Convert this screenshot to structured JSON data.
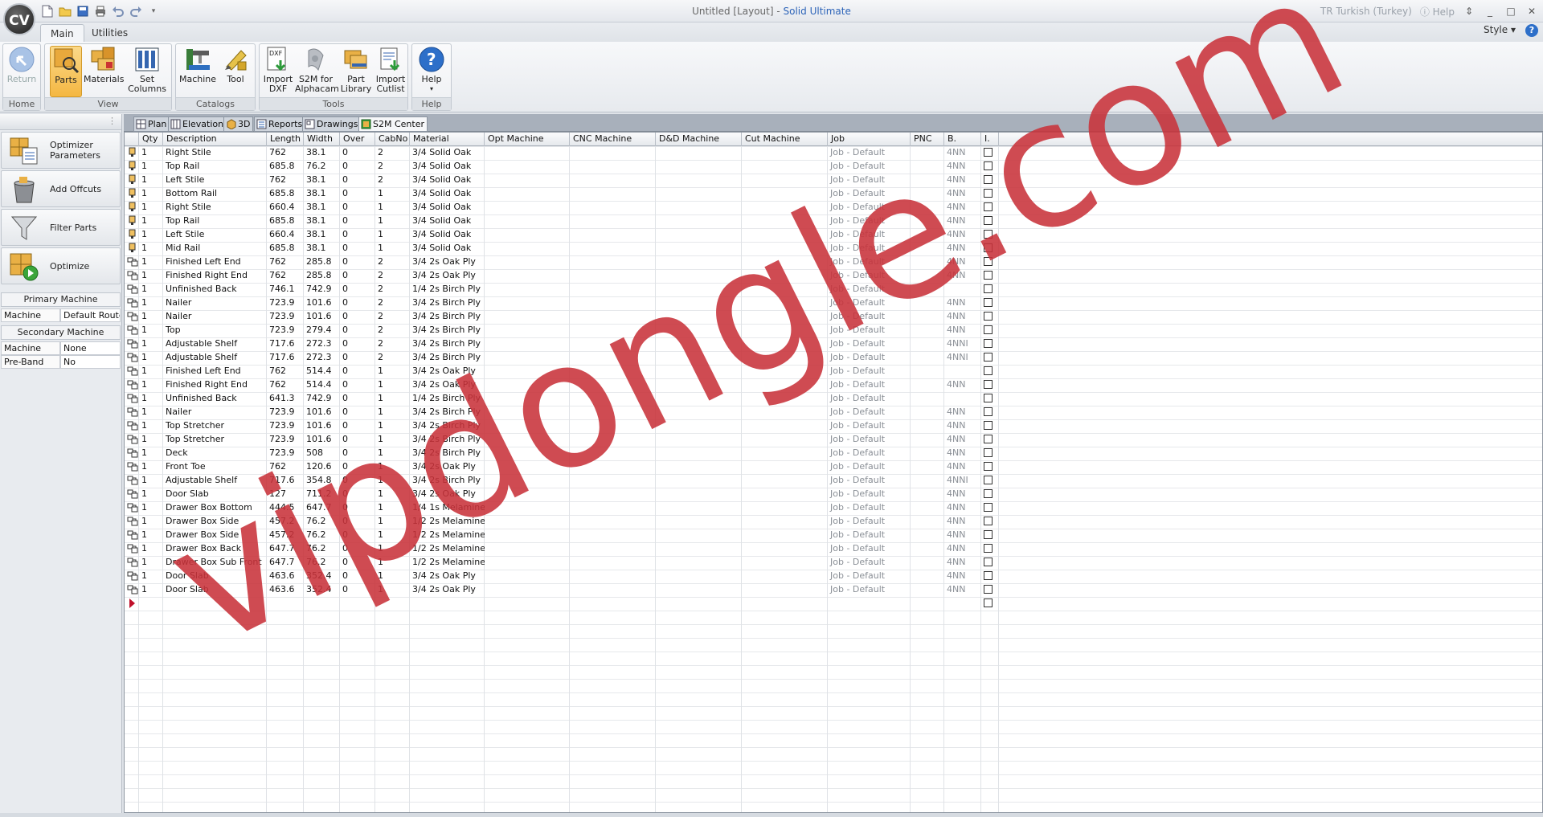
{
  "app": {
    "logo_text": "CV",
    "title_prefix": "Untitled [Layout] - ",
    "title_brand": "Solid Ultimate",
    "language": "TR Turkish (Turkey)",
    "help_label": "Help"
  },
  "ribbon_tabs": [
    {
      "label": "Main",
      "active": true
    },
    {
      "label": "Utilities",
      "active": false
    }
  ],
  "style_label": "Style",
  "ribbon": {
    "groups": {
      "home": "Home",
      "view": "View",
      "catalogs": "Catalogs",
      "tools": "Tools",
      "help": "Help"
    },
    "buttons": {
      "return": "Return",
      "parts": "Parts",
      "materials": "Materials",
      "set_columns_1": "Set",
      "set_columns_2": "Columns",
      "machine": "Machine",
      "tool": "Tool",
      "import_dxf_1": "Import",
      "import_dxf_2": "DXF",
      "s2m_1": "S2M for",
      "s2m_2": "Alphacam",
      "part_library_1": "Part",
      "part_library_2": "Library",
      "import_cutlist_1": "Import",
      "import_cutlist_2": "Cutlist",
      "help": "Help",
      "dxf_badge": "DXF"
    }
  },
  "left_panel": {
    "buttons": [
      {
        "label": "Optimizer Parameters"
      },
      {
        "label": "Add Offcuts"
      },
      {
        "label": "Filter Parts"
      },
      {
        "label": "Optimize"
      }
    ],
    "primary_title": "Primary Machine",
    "primary": {
      "key": "Machine",
      "value": "Default Router"
    },
    "secondary_title": "Secondary Machine",
    "secondary": {
      "key": "Machine",
      "value": "None"
    },
    "preband": {
      "key": "Pre-Band",
      "value": "No"
    }
  },
  "doc_tabs": [
    {
      "label": "Plan"
    },
    {
      "label": "Elevation"
    },
    {
      "label": "3D"
    },
    {
      "label": "Reports"
    },
    {
      "label": "Drawings"
    },
    {
      "label": "S2M Center",
      "active": true
    }
  ],
  "grid": {
    "columns": [
      "",
      "Qty",
      "Description",
      "Length",
      "Width",
      "Over",
      "CabNo",
      "Material",
      "Opt Machine",
      "CNC Machine",
      "D&D Machine",
      "Cut Machine",
      "Job",
      "PNC",
      "B.",
      "I."
    ],
    "rows": [
      {
        "type": "solid",
        "qty": "1",
        "desc": "Right Stile",
        "len": "762",
        "wid": "38.1",
        "over": "0",
        "cab": "2",
        "mat": "3/4 Solid Oak",
        "job": "Job - Default",
        "b": "4NN"
      },
      {
        "type": "solid",
        "qty": "1",
        "desc": "Top Rail",
        "len": "685.8",
        "wid": "76.2",
        "over": "0",
        "cab": "2",
        "mat": "3/4 Solid Oak",
        "job": "Job - Default",
        "b": "4NN"
      },
      {
        "type": "solid",
        "qty": "1",
        "desc": "Left Stile",
        "len": "762",
        "wid": "38.1",
        "over": "0",
        "cab": "2",
        "mat": "3/4 Solid Oak",
        "job": "Job - Default",
        "b": "4NN"
      },
      {
        "type": "solid",
        "qty": "1",
        "desc": "Bottom Rail",
        "len": "685.8",
        "wid": "38.1",
        "over": "0",
        "cab": "1",
        "mat": "3/4 Solid Oak",
        "job": "Job - Default",
        "b": "4NN"
      },
      {
        "type": "solid",
        "qty": "1",
        "desc": "Right Stile",
        "len": "660.4",
        "wid": "38.1",
        "over": "0",
        "cab": "1",
        "mat": "3/4 Solid Oak",
        "job": "Job - Default",
        "b": "4NN"
      },
      {
        "type": "solid",
        "qty": "1",
        "desc": "Top Rail",
        "len": "685.8",
        "wid": "38.1",
        "over": "0",
        "cab": "1",
        "mat": "3/4 Solid Oak",
        "job": "Job - Default",
        "b": "4NN"
      },
      {
        "type": "solid",
        "qty": "1",
        "desc": "Left Stile",
        "len": "660.4",
        "wid": "38.1",
        "over": "0",
        "cab": "1",
        "mat": "3/4 Solid Oak",
        "job": "Job - Default",
        "b": "4NN"
      },
      {
        "type": "solid",
        "qty": "1",
        "desc": "Mid Rail",
        "len": "685.8",
        "wid": "38.1",
        "over": "0",
        "cab": "1",
        "mat": "3/4 Solid Oak",
        "job": "Job - Default",
        "b": "4NN"
      },
      {
        "type": "panel",
        "qty": "1",
        "desc": "Finished Left End",
        "len": "762",
        "wid": "285.8",
        "over": "0",
        "cab": "2",
        "mat": "3/4 2s Oak Ply",
        "job": "Job - Default",
        "b": "4NN"
      },
      {
        "type": "panel",
        "qty": "1",
        "desc": "Finished Right End",
        "len": "762",
        "wid": "285.8",
        "over": "0",
        "cab": "2",
        "mat": "3/4 2s Oak Ply",
        "job": "Job - Default",
        "b": "4NN"
      },
      {
        "type": "panel",
        "qty": "1",
        "desc": "Unfinished Back",
        "len": "746.1",
        "wid": "742.9",
        "over": "0",
        "cab": "2",
        "mat": "1/4 2s Birch Ply",
        "job": "Job - Default",
        "b": ""
      },
      {
        "type": "panel",
        "qty": "1",
        "desc": "Nailer",
        "len": "723.9",
        "wid": "101.6",
        "over": "0",
        "cab": "2",
        "mat": "3/4 2s Birch Ply",
        "job": "Job - Default",
        "b": "4NN"
      },
      {
        "type": "panel",
        "qty": "1",
        "desc": "Nailer",
        "len": "723.9",
        "wid": "101.6",
        "over": "0",
        "cab": "2",
        "mat": "3/4 2s Birch Ply",
        "job": "Job - Default",
        "b": "4NN"
      },
      {
        "type": "panel",
        "qty": "1",
        "desc": "Top",
        "len": "723.9",
        "wid": "279.4",
        "over": "0",
        "cab": "2",
        "mat": "3/4 2s Birch Ply",
        "job": "Job - Default",
        "b": "4NN"
      },
      {
        "type": "panel",
        "qty": "1",
        "desc": "Adjustable Shelf",
        "len": "717.6",
        "wid": "272.3",
        "over": "0",
        "cab": "2",
        "mat": "3/4 2s Birch Ply",
        "job": "Job - Default",
        "b": "4NNI"
      },
      {
        "type": "panel",
        "qty": "1",
        "desc": "Adjustable Shelf",
        "len": "717.6",
        "wid": "272.3",
        "over": "0",
        "cab": "2",
        "mat": "3/4 2s Birch Ply",
        "job": "Job - Default",
        "b": "4NNI"
      },
      {
        "type": "panel",
        "qty": "1",
        "desc": "Finished Left End",
        "len": "762",
        "wid": "514.4",
        "over": "0",
        "cab": "1",
        "mat": "3/4 2s Oak Ply",
        "job": "Job - Default",
        "b": ""
      },
      {
        "type": "panel",
        "qty": "1",
        "desc": "Finished Right End",
        "len": "762",
        "wid": "514.4",
        "over": "0",
        "cab": "1",
        "mat": "3/4 2s Oak Ply",
        "job": "Job - Default",
        "b": "4NN"
      },
      {
        "type": "panel",
        "qty": "1",
        "desc": "Unfinished Back",
        "len": "641.3",
        "wid": "742.9",
        "over": "0",
        "cab": "1",
        "mat": "1/4 2s Birch Ply",
        "job": "Job - Default",
        "b": ""
      },
      {
        "type": "panel",
        "qty": "1",
        "desc": "Nailer",
        "len": "723.9",
        "wid": "101.6",
        "over": "0",
        "cab": "1",
        "mat": "3/4 2s Birch Ply",
        "job": "Job - Default",
        "b": "4NN"
      },
      {
        "type": "panel",
        "qty": "1",
        "desc": "Top Stretcher",
        "len": "723.9",
        "wid": "101.6",
        "over": "0",
        "cab": "1",
        "mat": "3/4 2s Birch Ply",
        "job": "Job - Default",
        "b": "4NN"
      },
      {
        "type": "panel",
        "qty": "1",
        "desc": "Top Stretcher",
        "len": "723.9",
        "wid": "101.6",
        "over": "0",
        "cab": "1",
        "mat": "3/4 2s Birch Ply",
        "job": "Job - Default",
        "b": "4NN"
      },
      {
        "type": "panel",
        "qty": "1",
        "desc": "Deck",
        "len": "723.9",
        "wid": "508",
        "over": "0",
        "cab": "1",
        "mat": "3/4 2s Birch Ply",
        "job": "Job - Default",
        "b": "4NN"
      },
      {
        "type": "panel",
        "qty": "1",
        "desc": "Front Toe",
        "len": "762",
        "wid": "120.6",
        "over": "0",
        "cab": "1",
        "mat": "3/4 2s Oak Ply",
        "job": "Job - Default",
        "b": "4NN"
      },
      {
        "type": "panel",
        "qty": "1",
        "desc": "Adjustable Shelf",
        "len": "717.6",
        "wid": "354.8",
        "over": "0",
        "cab": "1",
        "mat": "3/4 2s Birch Ply",
        "job": "Job - Default",
        "b": "4NNI"
      },
      {
        "type": "panel",
        "qty": "1",
        "desc": "Door Slab",
        "len": "127",
        "wid": "711.2",
        "over": "0",
        "cab": "1",
        "mat": "3/4 2s Oak Ply",
        "job": "Job - Default",
        "b": "4NN"
      },
      {
        "type": "panel",
        "qty": "1",
        "desc": "Drawer Box Bottom",
        "len": "444.5",
        "wid": "647.7",
        "over": "0",
        "cab": "1",
        "mat": "1/4 1s Melamine",
        "job": "Job - Default",
        "b": "4NN"
      },
      {
        "type": "panel",
        "qty": "1",
        "desc": "Drawer Box Side",
        "len": "457.2",
        "wid": "76.2",
        "over": "0",
        "cab": "1",
        "mat": "1/2 2s Melamine",
        "job": "Job - Default",
        "b": "4NN"
      },
      {
        "type": "panel",
        "qty": "1",
        "desc": "Drawer Box Side",
        "len": "457.2",
        "wid": "76.2",
        "over": "0",
        "cab": "1",
        "mat": "1/2 2s Melamine",
        "job": "Job - Default",
        "b": "4NN"
      },
      {
        "type": "panel",
        "qty": "1",
        "desc": "Drawer Box Back",
        "len": "647.7",
        "wid": "76.2",
        "over": "0",
        "cab": "1",
        "mat": "1/2 2s Melamine",
        "job": "Job - Default",
        "b": "4NN"
      },
      {
        "type": "panel",
        "qty": "1",
        "desc": "Drawer Box Sub Front",
        "len": "647.7",
        "wid": "76.2",
        "over": "0",
        "cab": "1",
        "mat": "1/2 2s Melamine",
        "job": "Job - Default",
        "b": "4NN"
      },
      {
        "type": "panel",
        "qty": "1",
        "desc": "Door Slab",
        "len": "463.6",
        "wid": "352.4",
        "over": "0",
        "cab": "1",
        "mat": "3/4 2s Oak Ply",
        "job": "Job - Default",
        "b": "4NN"
      },
      {
        "type": "panel",
        "qty": "1",
        "desc": "Door Slab",
        "len": "463.6",
        "wid": "352.4",
        "over": "0",
        "cab": "1",
        "mat": "3/4 2s Oak Ply",
        "job": "Job - Default",
        "b": "4NN"
      }
    ]
  },
  "watermark": {
    "text": "vipdongle.com",
    "color": "#c8323a"
  },
  "colors": {
    "accent": "#2c63b8",
    "active_button": "#f4b742"
  }
}
